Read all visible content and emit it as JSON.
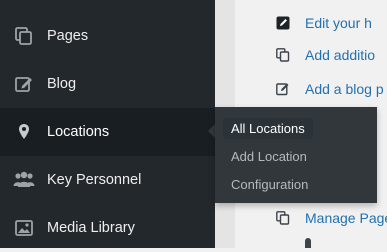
{
  "sidebar": {
    "items": [
      {
        "label": "Pages",
        "icon": "pages-icon"
      },
      {
        "label": "Blog",
        "icon": "blog-edit-icon"
      },
      {
        "label": "Locations",
        "icon": "location-pin-icon"
      },
      {
        "label": "Key Personnel",
        "icon": "people-group-icon"
      },
      {
        "label": "Media Library",
        "icon": "image-icon"
      }
    ],
    "active": "Locations"
  },
  "flyout": {
    "items": [
      {
        "label": "All Locations"
      },
      {
        "label": "Add Location"
      },
      {
        "label": "Configuration"
      }
    ]
  },
  "content": {
    "links": [
      {
        "text": "Edit your h",
        "icon": "edit-square-icon"
      },
      {
        "text": "Add additio",
        "icon": "copy-icon"
      },
      {
        "text": "Add a blog p",
        "icon": "edit-pencil-icon"
      },
      {
        "text": "Manage Page",
        "icon": "copy-icon"
      }
    ]
  },
  "colors": {
    "sidebar_bg": "#23282d",
    "active_bg": "#191e23",
    "flyout_bg": "#32373c",
    "link_color": "#2271b1"
  }
}
